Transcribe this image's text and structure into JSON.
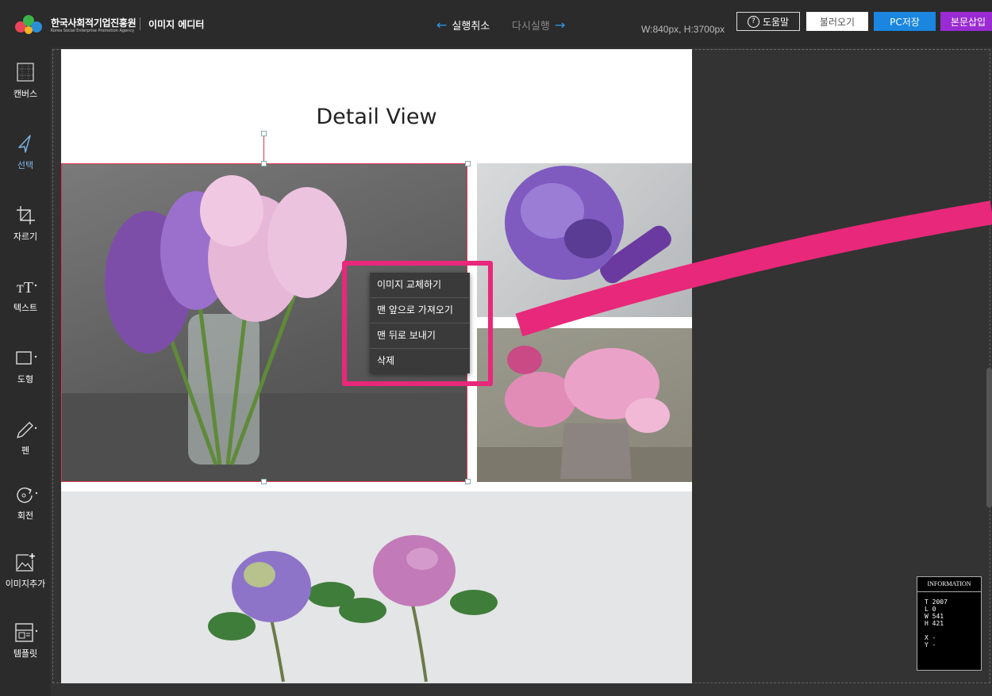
{
  "header": {
    "org_name": "한국사회적기업진흥원",
    "org_sub": "Korea Social Enterprise Promotion Agency",
    "app_title": "이미지 에디터",
    "undo_label": "실행취소",
    "redo_label": "다시실행",
    "dimensions": "W:840px, H:3700px",
    "help_label": "도움말",
    "load_label": "불러오기",
    "pc_save_label": "PC저장",
    "insert_label": "본문삽입"
  },
  "sidebar": {
    "items": [
      {
        "label": "캔버스",
        "icon": "canvas-grid-icon"
      },
      {
        "label": "선택",
        "icon": "cursor-icon"
      },
      {
        "label": "자르기",
        "icon": "crop-icon"
      },
      {
        "label": "텍스트",
        "icon": "text-icon"
      },
      {
        "label": "도형",
        "icon": "shape-icon"
      },
      {
        "label": "펜",
        "icon": "pen-icon"
      },
      {
        "label": "회전",
        "icon": "rotate-icon"
      },
      {
        "label": "이미지추가",
        "icon": "add-image-icon"
      },
      {
        "label": "템플릿",
        "icon": "template-icon"
      }
    ]
  },
  "canvas": {
    "title": "Detail View"
  },
  "context_menu": {
    "items": [
      "이미지 교체하기",
      "맨 앞으로 가져오기",
      "맨 뒤로 보내기",
      "삭제"
    ]
  },
  "info": {
    "title": "INFORMATION",
    "t": "T  2007",
    "l": " L  0",
    "w": "W  541",
    "h": " H  421",
    "x": " X  -",
    "y": " Y  -"
  },
  "colors": {
    "accent_blue": "#1a86e0",
    "accent_purple": "#9a2bd3",
    "highlight_pink": "#e8287a",
    "selection_red": "#e0374e"
  }
}
